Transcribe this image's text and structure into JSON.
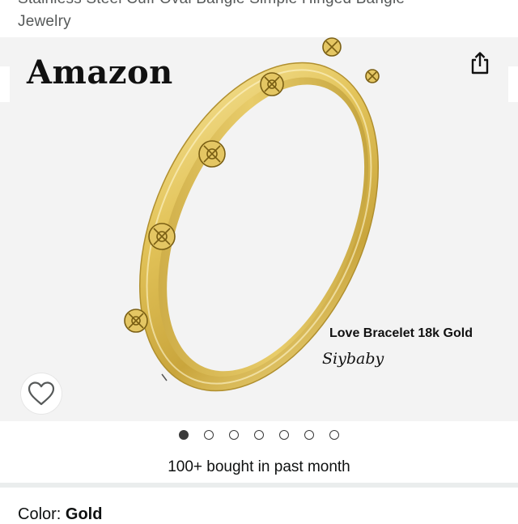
{
  "product": {
    "title_line1": "Stainless Steel Cuff Oval Bangle Simple Hinged Bangle",
    "title_line2": "Jewelry"
  },
  "gallery": {
    "watermark": "Amazon",
    "caption_line1": "Love Bracelet 18k Gold",
    "caption_line2": "Siybaby",
    "share_icon": "share-icon",
    "favorite_icon": "heart-outline-icon",
    "image_count": 7,
    "active_index": 0
  },
  "social_proof": {
    "bought_text": "100+ bought in past month"
  },
  "variation": {
    "label": "Color: ",
    "value": "Gold"
  },
  "colors": {
    "gold_light": "#f3d97a",
    "gold_mid": "#d9b84a",
    "gold_dark": "#a8862a",
    "gallery_bg": "#f3f3f3",
    "dot_color": "#3a3a3a"
  }
}
